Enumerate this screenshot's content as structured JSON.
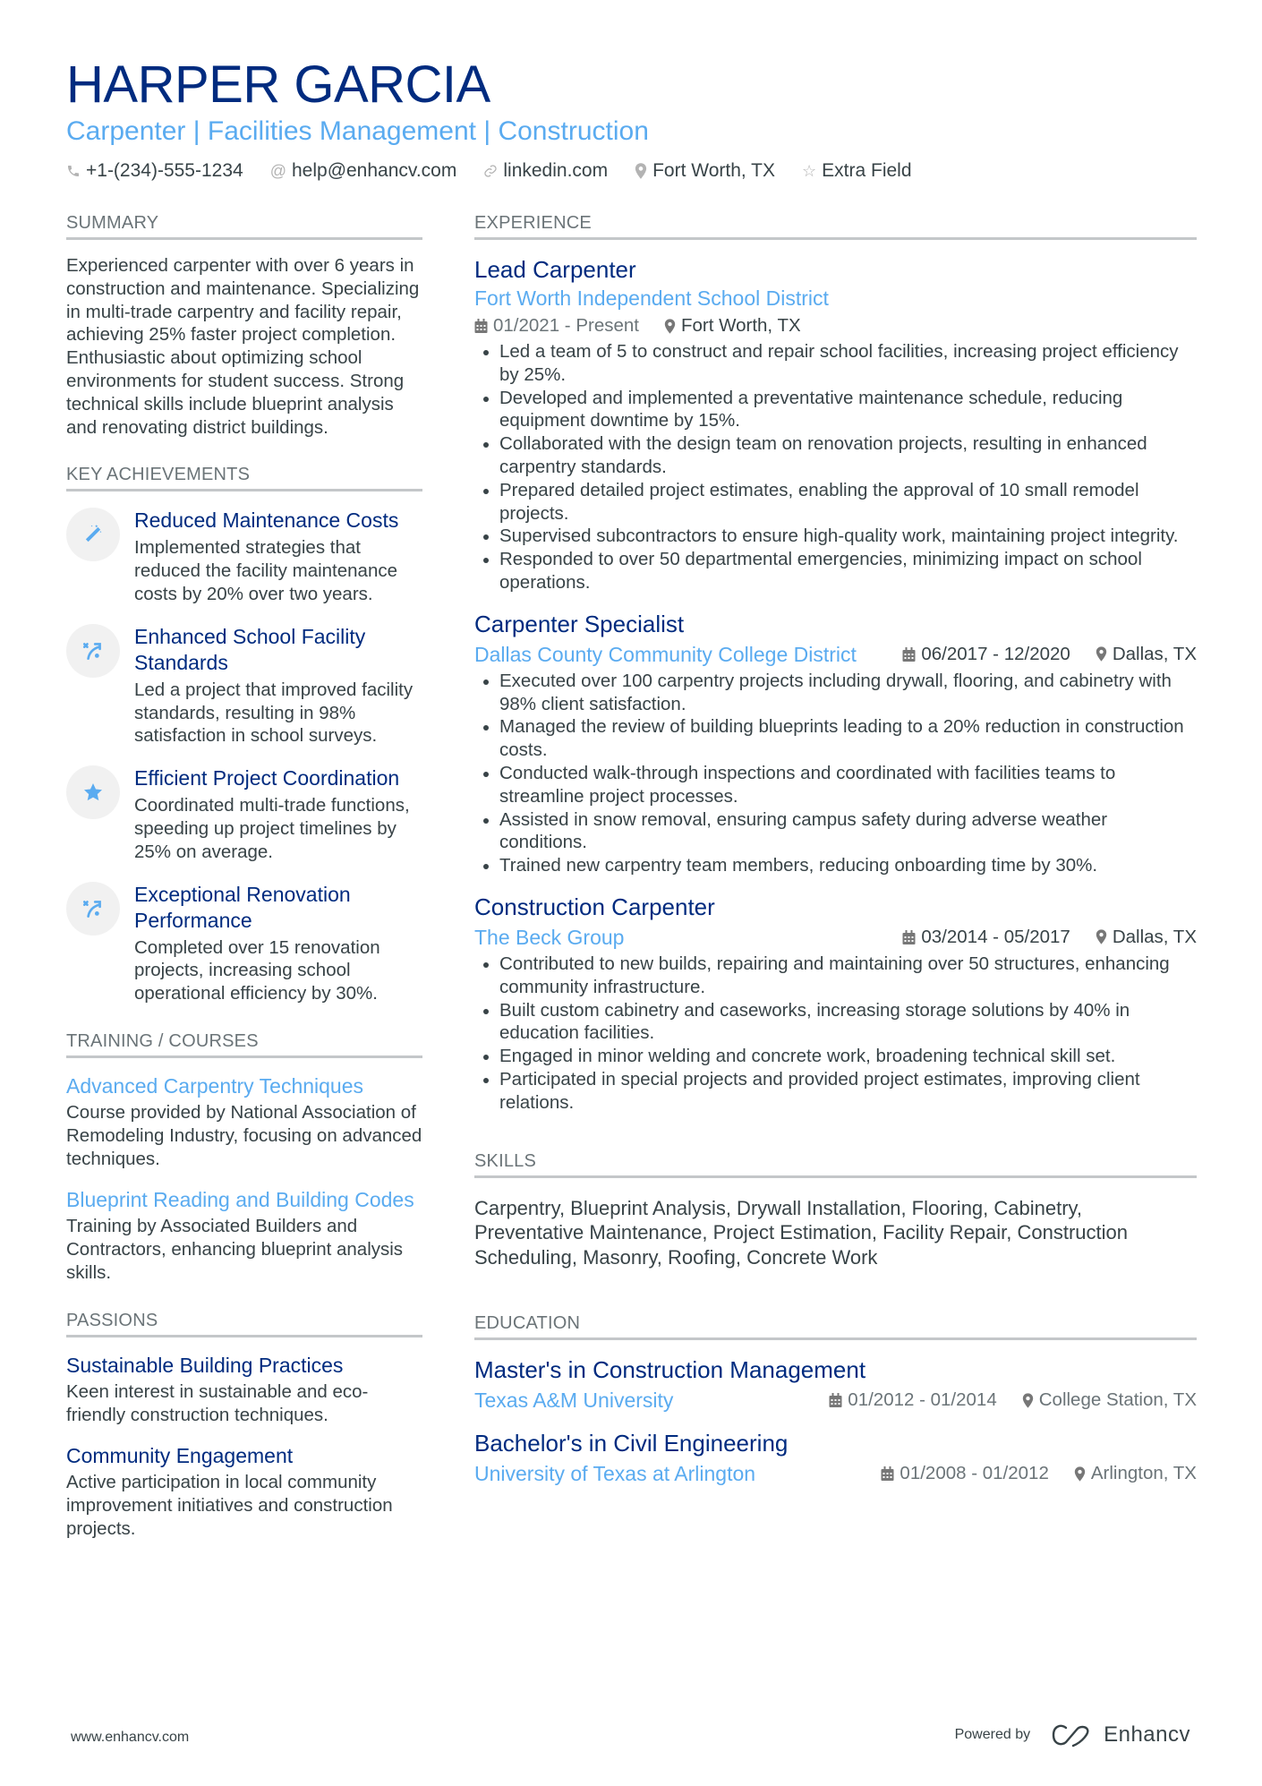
{
  "header": {
    "name": "HARPER GARCIA",
    "subtitle": "Carpenter | Facilities Management | Construction",
    "contacts": [
      {
        "icon": "phone-icon",
        "text": "+1-(234)-555-1234"
      },
      {
        "icon": "at-icon",
        "text": "help@enhancv.com"
      },
      {
        "icon": "link-icon",
        "text": "linkedin.com"
      },
      {
        "icon": "location-icon",
        "text": "Fort Worth, TX"
      },
      {
        "icon": "star-icon",
        "text": "Extra Field"
      }
    ]
  },
  "summary": {
    "title": "SUMMARY",
    "text": "Experienced carpenter with over 6 years in construction and maintenance. Specializing in multi-trade carpentry and facility repair, achieving 25% faster project completion. Enthusiastic about optimizing school environments for student success. Strong technical skills include blueprint analysis and renovating district buildings."
  },
  "achievements": {
    "title": "KEY ACHIEVEMENTS",
    "items": [
      {
        "icon": "magic-wand-icon",
        "title": "Reduced Maintenance Costs",
        "desc": "Implemented strategies that reduced the facility maintenance costs by 20% over two years."
      },
      {
        "icon": "strategy-icon",
        "title": "Enhanced School Facility Standards",
        "desc": "Led a project that improved facility standards, resulting in 98% satisfaction in school surveys."
      },
      {
        "icon": "star-icon",
        "title": "Efficient Project Coordination",
        "desc": "Coordinated multi-trade functions, speeding up project timelines by 25% on average."
      },
      {
        "icon": "strategy-icon",
        "title": "Exceptional Renovation Performance",
        "desc": "Completed over 15 renovation projects, increasing school operational efficiency by 30%."
      }
    ]
  },
  "training": {
    "title": "TRAINING / COURSES",
    "items": [
      {
        "title": "Advanced Carpentry Techniques",
        "desc": "Course provided by National Association of Remodeling Industry, focusing on advanced techniques."
      },
      {
        "title": "Blueprint Reading and Building Codes",
        "desc": "Training by Associated Builders and Contractors, enhancing blueprint analysis skills."
      }
    ]
  },
  "passions": {
    "title": "PASSIONS",
    "items": [
      {
        "title": "Sustainable Building Practices",
        "desc": "Keen interest in sustainable and eco-friendly construction techniques."
      },
      {
        "title": "Community Engagement",
        "desc": "Active participation in local community improvement initiatives and construction projects."
      }
    ]
  },
  "experience": {
    "title": "EXPERIENCE",
    "jobs": [
      {
        "title": "Lead Carpenter",
        "company": "Fort Worth Independent School District",
        "dates": "01/2021 - Present",
        "location": "Fort Worth, TX",
        "bullets": [
          "Led a team of 5 to construct and repair school facilities, increasing project efficiency by 25%.",
          "Developed and implemented a preventative maintenance schedule, reducing equipment downtime by 15%.",
          "Collaborated with the design team on renovation projects, resulting in enhanced carpentry standards.",
          "Prepared detailed project estimates, enabling the approval of 10 small remodel projects.",
          "Supervised subcontractors to ensure high-quality work, maintaining project integrity.",
          "Responded to over 50 departmental emergencies, minimizing impact on school operations."
        ]
      },
      {
        "title": "Carpenter Specialist",
        "company": "Dallas County Community College District",
        "dates": "06/2017 - 12/2020",
        "location": "Dallas, TX",
        "bullets": [
          "Executed over 100 carpentry projects including drywall, flooring, and cabinetry with 98% client satisfaction.",
          "Managed the review of building blueprints leading to a 20% reduction in construction costs.",
          "Conducted walk-through inspections and coordinated with facilities teams to streamline project processes.",
          "Assisted in snow removal, ensuring campus safety during adverse weather conditions.",
          "Trained new carpentry team members, reducing onboarding time by 30%."
        ]
      },
      {
        "title": "Construction Carpenter",
        "company": "The Beck Group",
        "dates": "03/2014 - 05/2017",
        "location": "Dallas, TX",
        "bullets": [
          "Contributed to new builds, repairing and maintaining over 50 structures, enhancing community infrastructure.",
          "Built custom cabinetry and caseworks, increasing storage solutions by 40% in education facilities.",
          "Engaged in minor welding and concrete work, broadening technical skill set.",
          "Participated in special projects and provided project estimates, improving client relations."
        ]
      }
    ]
  },
  "skills": {
    "title": "SKILLS",
    "text": "Carpentry, Blueprint Analysis, Drywall Installation, Flooring, Cabinetry, Preventative Maintenance, Project Estimation, Facility Repair, Construction Scheduling, Masonry, Roofing, Concrete Work"
  },
  "education": {
    "title": "EDUCATION",
    "items": [
      {
        "degree": "Master's in Construction Management",
        "school": "Texas A&M University",
        "dates": "01/2012 - 01/2014",
        "location": "College Station, TX"
      },
      {
        "degree": "Bachelor's in Civil Engineering",
        "school": "University of Texas at Arlington",
        "dates": "01/2008 - 01/2012",
        "location": "Arlington, TX"
      }
    ]
  },
  "footer": {
    "website": "www.enhancv.com",
    "powered_by": "Powered by",
    "brand": "Enhancv"
  },
  "colors": {
    "name": "#002b7f",
    "accent": "#5aabf0",
    "text": "#384347",
    "rule": "#c4c7c9"
  }
}
